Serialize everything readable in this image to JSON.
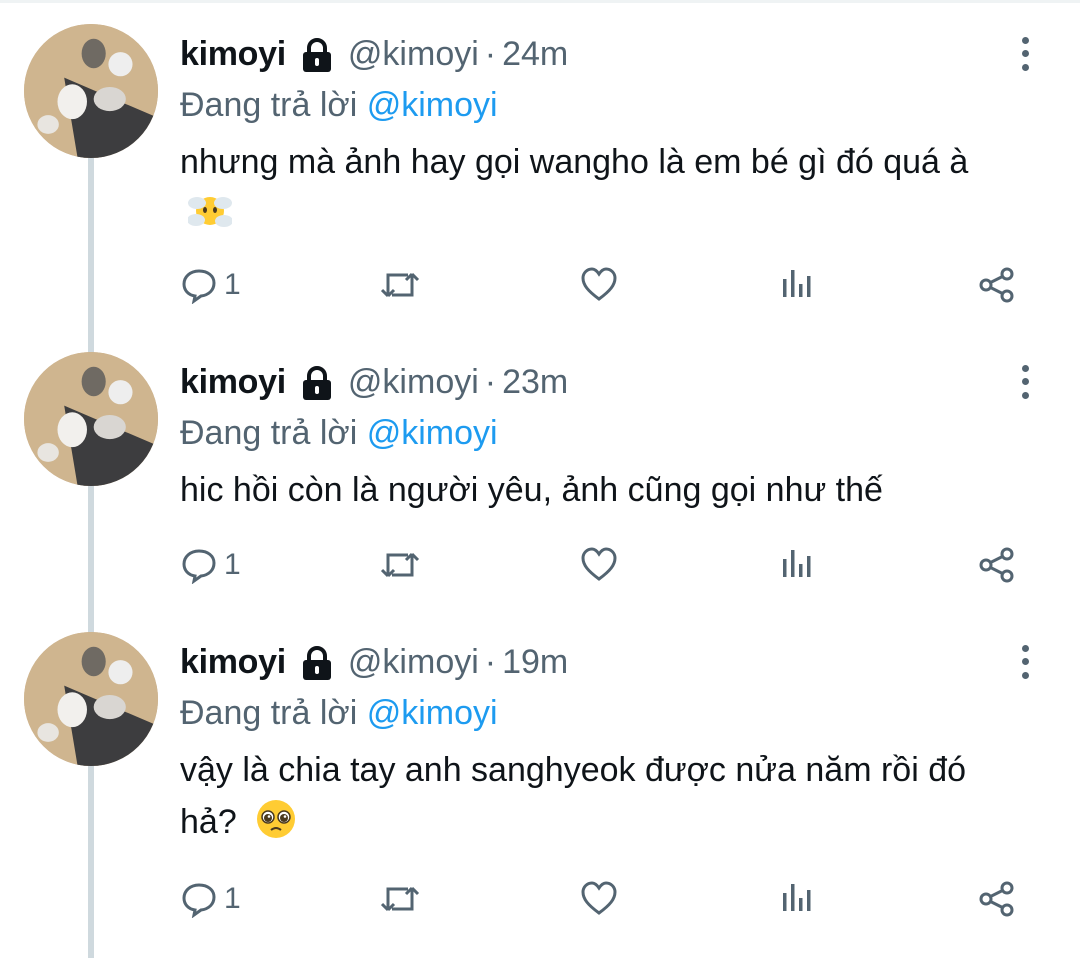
{
  "tweets": [
    {
      "name": "kimoyi",
      "handle": "@kimoyi",
      "separator": "·",
      "time": "24m",
      "replying_prefix": "Đang trả lời",
      "replying_to": "@kimoyi",
      "text": "nhưng mà ảnh hay gọi wangho là em bé gì đó quá à",
      "emoji": "face-in-clouds",
      "reply_count": "1"
    },
    {
      "name": "kimoyi",
      "handle": "@kimoyi",
      "separator": "·",
      "time": "23m",
      "replying_prefix": "Đang trả lời",
      "replying_to": "@kimoyi",
      "text": "hic hồi còn là người yêu, ảnh cũng gọi như thế",
      "emoji": "",
      "reply_count": "1"
    },
    {
      "name": "kimoyi",
      "handle": "@kimoyi",
      "separator": "·",
      "time": "19m",
      "replying_prefix": "Đang trả lời",
      "replying_to": "@kimoyi",
      "text": "vậy là chia tay anh sanghyeok được nửa năm rồi đó hả?",
      "emoji": "pleading-face",
      "reply_count": "1"
    }
  ],
  "icons": {
    "lock": "lock-icon",
    "more": "more-vertical-icon",
    "reply": "reply-icon",
    "retweet": "retweet-icon",
    "like": "heart-icon",
    "analytics": "analytics-icon",
    "share": "share-icon"
  },
  "colors": {
    "text": "#0f1419",
    "secondary": "#536471",
    "link": "#1d9bf0",
    "thread_line": "#cfd9de"
  }
}
